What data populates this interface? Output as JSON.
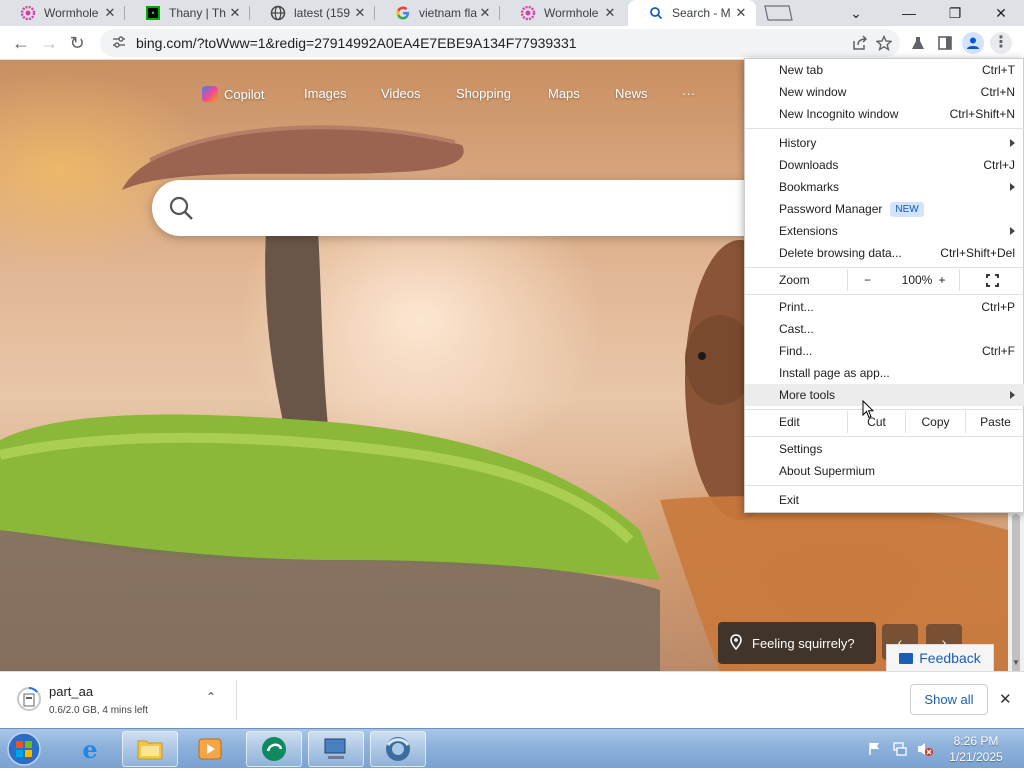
{
  "tabs": [
    {
      "title": "Wormhole",
      "icon": "flower-icon"
    },
    {
      "title": "Thany | Th",
      "icon": "terminal-icon"
    },
    {
      "title": "latest (159",
      "icon": "globe-icon"
    },
    {
      "title": "vietnam fla",
      "icon": "google-icon"
    },
    {
      "title": "Wormhole",
      "icon": "flower-icon"
    },
    {
      "title": "Search - M",
      "icon": "search-icon"
    }
  ],
  "address": {
    "url": "bing.com/?toWww=1&redig=27914992A0EA4E7EBE9A134F77939331"
  },
  "bing": {
    "nav": [
      "Copilot",
      "Images",
      "Videos",
      "Shopping",
      "Maps",
      "News",
      "···"
    ],
    "feeling": "Feeling squirrely?",
    "feedback": "Feedback"
  },
  "menu": {
    "new_tab": {
      "label": "New tab",
      "shortcut": "Ctrl+T"
    },
    "new_window": {
      "label": "New window",
      "shortcut": "Ctrl+N"
    },
    "new_incognito": {
      "label": "New Incognito window",
      "shortcut": "Ctrl+Shift+N"
    },
    "history": {
      "label": "History"
    },
    "downloads": {
      "label": "Downloads",
      "shortcut": "Ctrl+J"
    },
    "bookmarks": {
      "label": "Bookmarks"
    },
    "password_manager": {
      "label": "Password Manager",
      "badge": "NEW"
    },
    "extensions": {
      "label": "Extensions"
    },
    "delete_data": {
      "label": "Delete browsing data...",
      "shortcut": "Ctrl+Shift+Del"
    },
    "zoom": {
      "label": "Zoom",
      "minus": "−",
      "value": "100%",
      "plus": "+"
    },
    "print": {
      "label": "Print...",
      "shortcut": "Ctrl+P"
    },
    "cast": {
      "label": "Cast..."
    },
    "find": {
      "label": "Find...",
      "shortcut": "Ctrl+F"
    },
    "install": {
      "label": "Install page as app..."
    },
    "more_tools": {
      "label": "More tools"
    },
    "edit": {
      "label": "Edit",
      "cut": "Cut",
      "copy": "Copy",
      "paste": "Paste"
    },
    "settings": {
      "label": "Settings"
    },
    "about": {
      "label": "About Supermium"
    },
    "exit": {
      "label": "Exit"
    }
  },
  "download": {
    "filename": "part_aa",
    "status": "0.6/2.0 GB, 4 mins left",
    "show_all": "Show all"
  },
  "clock": {
    "time": "8:26 PM",
    "date": "1/21/2025"
  }
}
